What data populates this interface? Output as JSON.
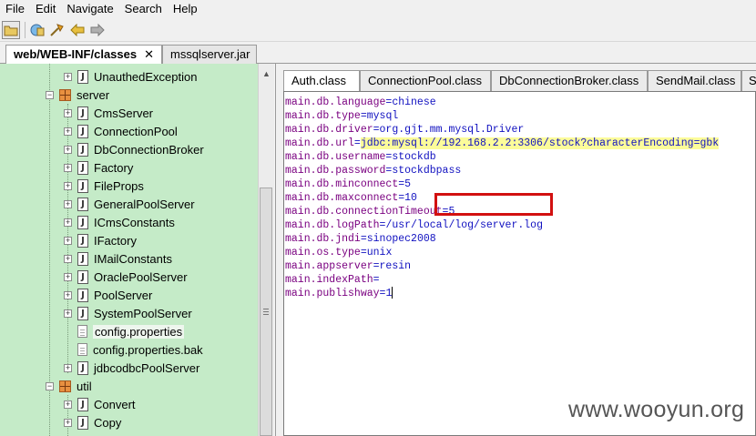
{
  "menubar": {
    "items": [
      "File",
      "Edit",
      "Navigate",
      "Search",
      "Help"
    ]
  },
  "toolbar": {
    "buttons": [
      "open-folder-icon",
      "open-file-icon",
      "build-icon",
      "back-arrow-icon",
      "forward-arrow-icon"
    ]
  },
  "outer_tabs": [
    {
      "label": "web/WEB-INF/classes",
      "active": true,
      "close": "✕"
    },
    {
      "label": "mssqlserver.jar",
      "active": false
    }
  ],
  "tree": {
    "rows": [
      {
        "label": "UnauthedException",
        "type": "class"
      },
      {
        "label": "server",
        "type": "package"
      },
      {
        "label": "CmsServer",
        "type": "class"
      },
      {
        "label": "ConnectionPool",
        "type": "class"
      },
      {
        "label": "DbConnectionBroker",
        "type": "class"
      },
      {
        "label": "Factory",
        "type": "class"
      },
      {
        "label": "FileProps",
        "type": "class"
      },
      {
        "label": "GeneralPoolServer",
        "type": "class"
      },
      {
        "label": "ICmsConstants",
        "type": "class"
      },
      {
        "label": "IFactory",
        "type": "class"
      },
      {
        "label": "IMailConstants",
        "type": "class"
      },
      {
        "label": "OraclePoolServer",
        "type": "class"
      },
      {
        "label": "PoolServer",
        "type": "class"
      },
      {
        "label": "SystemPoolServer",
        "type": "class"
      },
      {
        "label": "config.properties",
        "type": "file",
        "selected": true
      },
      {
        "label": "config.properties.bak",
        "type": "file"
      },
      {
        "label": "jdbcodbcPoolServer",
        "type": "class"
      },
      {
        "label": "util",
        "type": "package"
      },
      {
        "label": "Convert",
        "type": "class"
      },
      {
        "label": "Copy",
        "type": "class"
      }
    ]
  },
  "editor_tabs": [
    "Auth.class",
    "ConnectionPool.class",
    "DbConnectionBroker.class",
    "SendMail.class",
    "S"
  ],
  "code_lines": [
    {
      "key": "main.db.language",
      "eq": "=",
      "value": "chinese"
    },
    {
      "key": "main.db.type",
      "eq": "=",
      "value": "mysql"
    },
    {
      "key": "main.db.driver",
      "eq": "=",
      "value": "org.gjt.mm.mysql.Driver"
    },
    {
      "key": "main.db.url",
      "eq": "=",
      "value": "jdbc:mysql://192.168.2.2:3306/stock?characterEncoding=gbk"
    },
    {
      "key": "main.db.username",
      "eq": "=",
      "value": "stockdb"
    },
    {
      "key": "main.db.password",
      "eq": "=",
      "value": "stockdbpass"
    },
    {
      "key": "main.db.minconnect",
      "eq": "=",
      "value": "5"
    },
    {
      "key": "main.db.maxconnect",
      "eq": "=",
      "value": "10"
    },
    {
      "key": "main.db.connectionTimeout",
      "eq": "=",
      "value": "5"
    },
    {
      "key": "main.db.logPath",
      "eq": "=",
      "value": "/usr/local/log/server.log"
    },
    {
      "key": "main.db.jndi",
      "eq": "=",
      "value": "sinopec2008"
    },
    {
      "key": "main.os.type",
      "eq": "=",
      "value": "unix"
    },
    {
      "key": "main.appserver",
      "eq": "=",
      "value": "resin"
    },
    {
      "key": "main.indexPath",
      "eq": "=",
      "value": ""
    },
    {
      "key": "main.publishway",
      "eq": "=",
      "value": "1"
    }
  ],
  "watermark": "www.wooyun.org",
  "colors": {
    "tree_bg": "#c5ebc8",
    "code_text": "#1010c0",
    "highlight": "#fcfc9a",
    "red_box": "#d21010"
  }
}
